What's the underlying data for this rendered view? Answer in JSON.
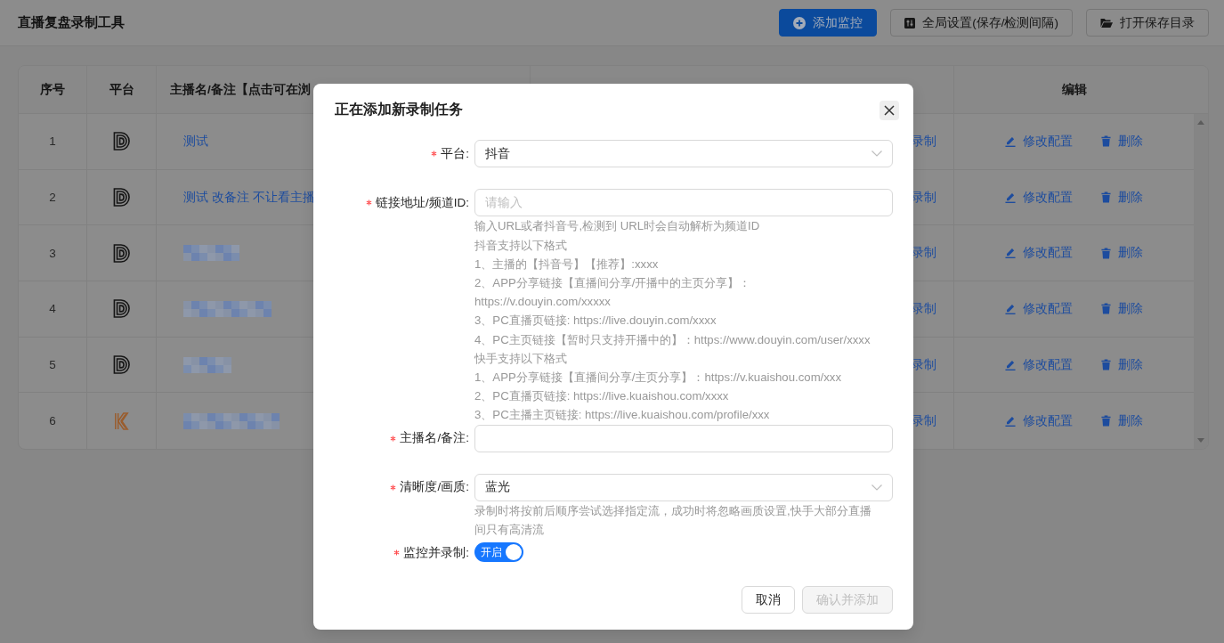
{
  "header": {
    "title": "直播复盘录制工具",
    "buttons": [
      {
        "kind": "add",
        "label": "添加监控"
      },
      {
        "kind": "settings",
        "label": "全局设置(保存/检测间隔)"
      },
      {
        "kind": "open-folder",
        "label": "打开保存目录"
      }
    ]
  },
  "table": {
    "columns": [
      "序号",
      "平台",
      "主播名/备注【点击可在浏",
      "编辑"
    ],
    "rows": [
      {
        "index": "1",
        "kind": "douyin",
        "blurred": false,
        "name": "测试",
        "column_4": "录制",
        "actions": [
          {
            "kind": "edit",
            "label": "修改配置"
          },
          {
            "kind": "delete",
            "label": "删除"
          }
        ]
      },
      {
        "index": "2",
        "kind": "douyin",
        "blurred": false,
        "name": "测试 改备注 不让看主播",
        "column_4": "录制",
        "actions": [
          {
            "kind": "edit",
            "label": "修改配置"
          },
          {
            "kind": "delete",
            "label": "删除"
          }
        ]
      },
      {
        "index": "3",
        "kind": "douyin",
        "blurred": true,
        "column_4": "录制",
        "actions": [
          {
            "kind": "edit",
            "label": "修改配置"
          },
          {
            "kind": "delete",
            "label": "删除"
          }
        ]
      },
      {
        "index": "4",
        "kind": "douyin",
        "blurred": true,
        "column_4": "录制",
        "actions": [
          {
            "kind": "edit",
            "label": "修改配置"
          },
          {
            "kind": "delete",
            "label": "删除"
          }
        ]
      },
      {
        "index": "5",
        "kind": "douyin",
        "blurred": true,
        "column_4": "录制",
        "actions": [
          {
            "kind": "edit",
            "label": "修改配置"
          },
          {
            "kind": "delete",
            "label": "删除"
          }
        ]
      },
      {
        "index": "6",
        "kind": "kuaishou",
        "blurred": true,
        "column_4": "录制",
        "actions": [
          {
            "kind": "edit",
            "label": "修改配置"
          },
          {
            "kind": "delete",
            "label": "删除"
          }
        ]
      }
    ]
  },
  "dialog": {
    "title": "正在添加新录制任务",
    "fields": [
      {
        "kind": "select",
        "label": "平台:",
        "required": true,
        "value": "抖音"
      },
      {
        "kind": "input",
        "label": "链接地址/频道ID:",
        "required": true,
        "placeholder": "请输入",
        "help": [
          "输入URL或者抖音号,检测到 URL时会自动解析为频道ID",
          "抖音支持以下格式",
          "1、主播的【抖音号】【推荐】:xxxx",
          "2、APP分享链接【直播间分享/开播中的主页分享】：",
          "https://v.douyin.com/xxxxx",
          "3、PC直播页链接: https://live.douyin.com/xxxx",
          "4、PC主页链接【暂时只支持开播中的】：https://www.douyin.com/user/xxxx",
          "快手支持以下格式",
          "1、APP分享链接【直播间分享/主页分享】：https://v.kuaishou.com/xxx",
          "2、PC直播页链接: https://live.kuaishou.com/xxxx",
          "3、PC主播主页链接: https://live.kuaishou.com/profile/xxx"
        ]
      },
      {
        "kind": "input",
        "label": "主播名/备注:",
        "required": true
      },
      {
        "kind": "select",
        "label": "清晰度/画质:",
        "required": true,
        "value": "蓝光",
        "help": [
          "录制时将按前后顺序尝试选择指定流，成功时将忽略画质设置,快手大部分直播间只有高清流"
        ]
      },
      {
        "kind": "switch",
        "label": "监控并录制:",
        "required": true,
        "on": true,
        "text": "开启"
      }
    ],
    "buttons": [
      {
        "kind": "cancel",
        "label": "取消",
        "disabled": false
      },
      {
        "kind": "confirm",
        "label": "确认并添加",
        "disabled": true
      }
    ]
  }
}
